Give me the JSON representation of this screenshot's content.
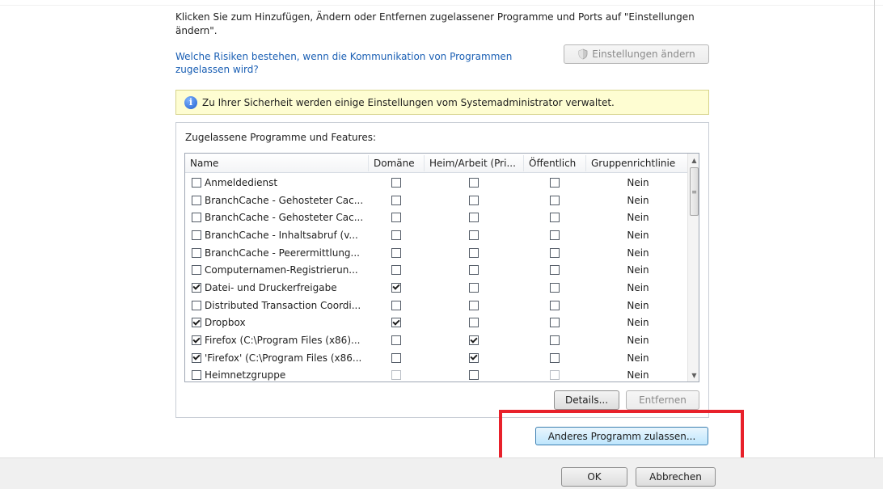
{
  "intro_text": "Klicken Sie zum Hinzufügen, Ändern oder Entfernen zugelassener Programme und Ports auf \"Einstellungen ändern\".",
  "risk_link": "Welche Risiken bestehen, wenn die Kommunikation von Programmen zugelassen wird?",
  "settings_button": "Einstellungen ändern",
  "info_bar": "Zu Ihrer Sicherheit werden einige Einstellungen vom Systemadministrator verwaltet.",
  "group_title": "Zugelassene Programme und Features:",
  "columns": [
    "Name",
    "Domäne",
    "Heim/Arbeit (Pri...",
    "Öffentlich",
    "Gruppenrichtlinie"
  ],
  "rows": [
    {
      "name": "Anmeldedienst",
      "enabled": false,
      "domain": false,
      "home": false,
      "public": false,
      "policy": "Nein"
    },
    {
      "name": "BranchCache - Gehosteter Cac...",
      "enabled": false,
      "domain": false,
      "home": false,
      "public": false,
      "policy": "Nein"
    },
    {
      "name": "BranchCache - Gehosteter Cac...",
      "enabled": false,
      "domain": false,
      "home": false,
      "public": false,
      "policy": "Nein"
    },
    {
      "name": "BranchCache - Inhaltsabruf (v...",
      "enabled": false,
      "domain": false,
      "home": false,
      "public": false,
      "policy": "Nein"
    },
    {
      "name": "BranchCache - Peerermittlung...",
      "enabled": false,
      "domain": false,
      "home": false,
      "public": false,
      "policy": "Nein"
    },
    {
      "name": "Computernamen-Registrierun...",
      "enabled": false,
      "domain": false,
      "home": false,
      "public": false,
      "policy": "Nein"
    },
    {
      "name": "Datei- und Druckerfreigabe",
      "enabled": true,
      "domain": true,
      "home": false,
      "public": false,
      "policy": "Nein"
    },
    {
      "name": "Distributed Transaction Coordi...",
      "enabled": false,
      "domain": false,
      "home": false,
      "public": false,
      "policy": "Nein"
    },
    {
      "name": "Dropbox",
      "enabled": true,
      "domain": true,
      "home": false,
      "public": false,
      "policy": "Nein"
    },
    {
      "name": "Firefox (C:\\Program Files (x86)...",
      "enabled": true,
      "domain": false,
      "home": true,
      "public": false,
      "policy": "Nein"
    },
    {
      "name": "'Firefox' (C:\\Program Files (x86...",
      "enabled": true,
      "domain": false,
      "home": true,
      "public": false,
      "policy": "Nein"
    },
    {
      "name": "Heimnetzgruppe",
      "enabled": false,
      "domain": false,
      "home": false,
      "public": false,
      "policy": "Nein"
    }
  ],
  "details_button": "Details...",
  "remove_button": "Entfernen",
  "allow_button": "Anderes Programm zulassen...",
  "ok_button": "OK",
  "cancel_button": "Abbrechen",
  "colors": {
    "highlight": "#e8212b",
    "link": "#1a5fb4",
    "info_bg": "#fefdd2"
  }
}
